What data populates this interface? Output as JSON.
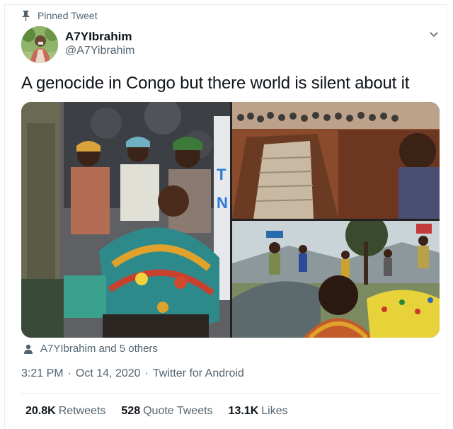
{
  "tweet": {
    "pinned_label": "Pinned Tweet",
    "display_name": "A7YIbrahim",
    "handle": "@A7Yibrahim",
    "text": "A genocide in Congo but there world is silent about it",
    "tagged_text": "A7YIbrahim and 5 others",
    "time": "3:21 PM",
    "date": "Oct 14, 2020",
    "source": "Twitter for Android",
    "stats": [
      {
        "count": "20.8K",
        "label": "Retweets"
      },
      {
        "count": "528",
        "label": "Quote Tweets"
      },
      {
        "count": "13.1K",
        "label": "Likes"
      }
    ]
  },
  "colors": {
    "text": "#0f1419",
    "secondary": "#536471",
    "border": "#e6ecf0"
  },
  "icons": [
    "pin-icon",
    "chevron-down-icon",
    "person-icon"
  ]
}
